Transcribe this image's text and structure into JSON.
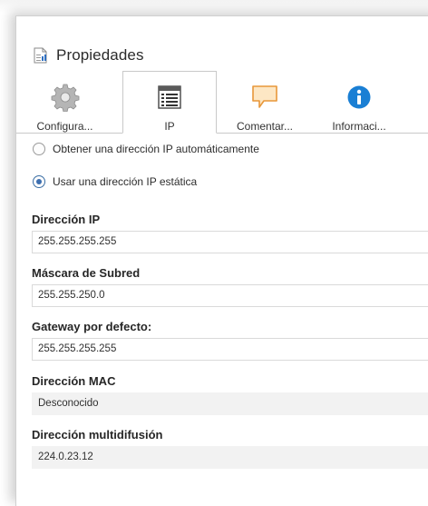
{
  "window": {
    "title": "Propiedades",
    "icon": "properties-doc-icon"
  },
  "tabs": [
    {
      "label": "Configura...",
      "icon": "gear-icon",
      "active": false
    },
    {
      "label": "IP",
      "icon": "ip-list-icon",
      "active": true
    },
    {
      "label": "Comentar...",
      "icon": "comment-icon",
      "active": false
    },
    {
      "label": "Informaci...",
      "icon": "info-icon",
      "active": false
    }
  ],
  "ip_mode": {
    "options": [
      {
        "label": "Obtener una dirección IP automáticamente",
        "selected": false
      },
      {
        "label": "Usar una dirección IP estática",
        "selected": true
      }
    ]
  },
  "fields": {
    "ip_address": {
      "label": "Dirección IP",
      "value": "255.255.255.255",
      "editable": true
    },
    "subnet_mask": {
      "label": "Máscara de Subred",
      "value": "255.255.250.0",
      "editable": true
    },
    "gateway": {
      "label": "Gateway por defecto:",
      "value": "255.255.255.255",
      "editable": true
    },
    "mac": {
      "label": "Dirección MAC",
      "value": "Desconocido",
      "editable": false
    },
    "multicast": {
      "label": "Dirección multidifusión",
      "value": "224.0.23.12",
      "editable": false
    }
  },
  "colors": {
    "accent": "#3d6fb0",
    "info_blue": "#1a7fd4",
    "comment_orange": "#e8973a"
  }
}
